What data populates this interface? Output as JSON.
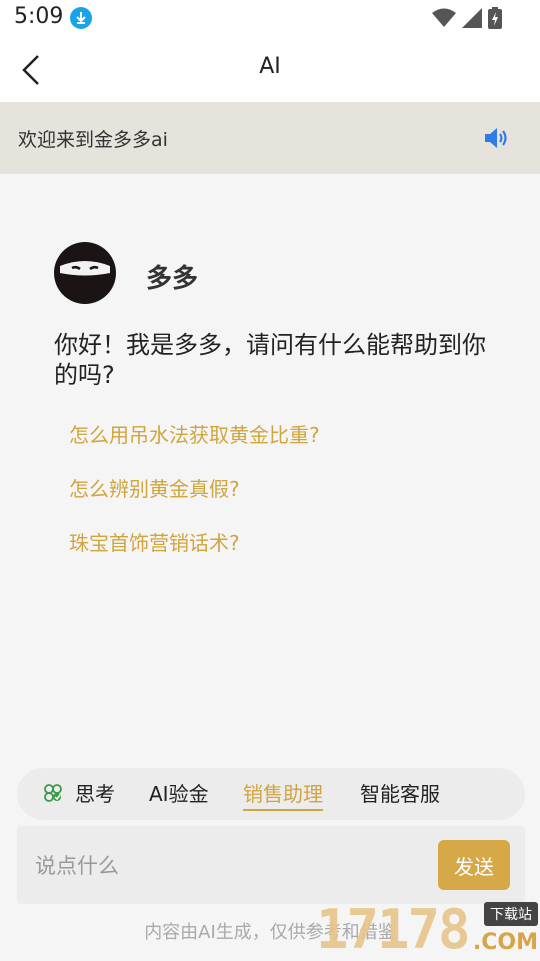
{
  "status": {
    "time": "5:09"
  },
  "nav": {
    "title": "AI"
  },
  "welcome": {
    "text": "欢迎来到金多多ai"
  },
  "bot": {
    "name": "多多",
    "greeting": "你好！我是多多，请问有什么能帮助到你的吗?"
  },
  "suggestions": [
    "怎么用吊水法获取黄金比重?",
    "怎么辨别黄金真假?",
    "珠宝首饰营销话术?"
  ],
  "modes": [
    {
      "label": "思考",
      "active": false
    },
    {
      "label": "AI验金",
      "active": false
    },
    {
      "label": "销售助理",
      "active": true
    },
    {
      "label": "智能客服",
      "active": false
    }
  ],
  "input": {
    "placeholder": "说点什么",
    "value": ""
  },
  "send": {
    "label": "发送"
  },
  "disclaimer": "内容由AI生成，仅供参考和借鉴",
  "watermark": {
    "number": "17178",
    "badge": "下载站",
    "domain": ".COM"
  },
  "colors": {
    "accent": "#d1a53e",
    "speaker": "#2f7be8",
    "download": "#1aa3e8"
  }
}
